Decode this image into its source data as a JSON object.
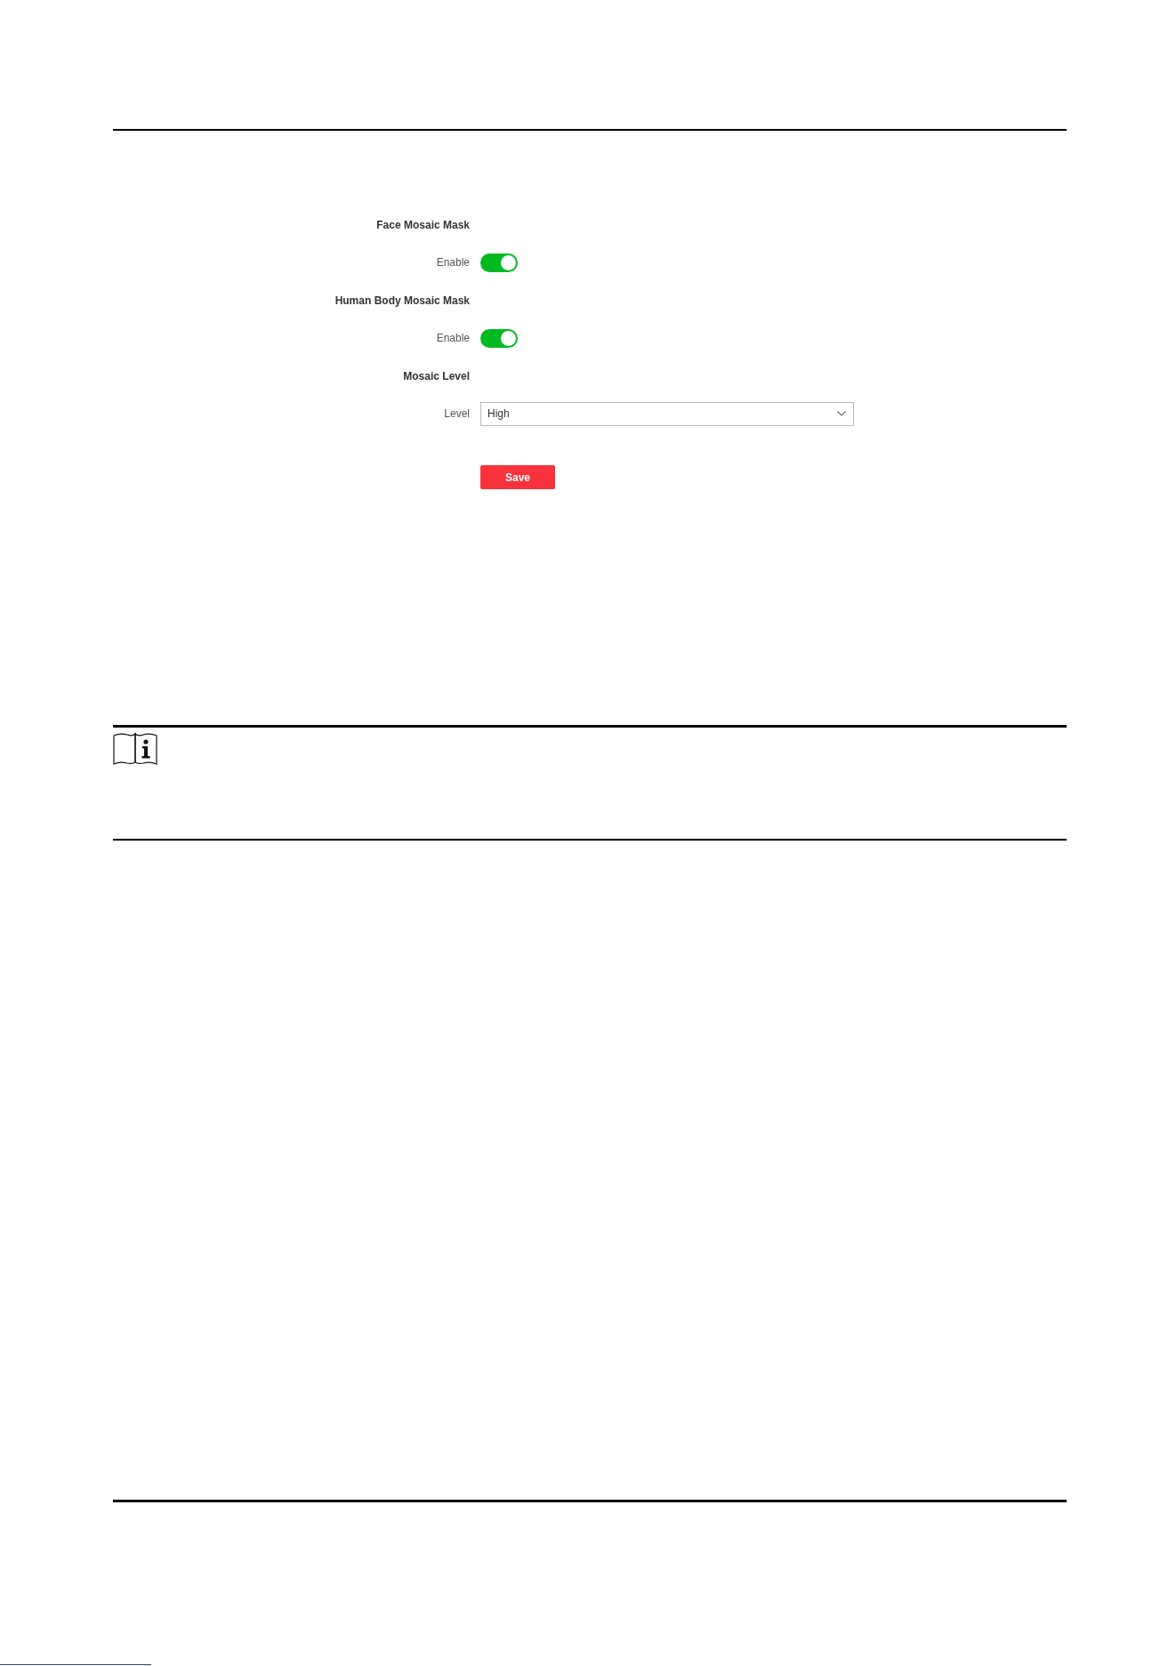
{
  "form": {
    "rows": [
      {
        "kind": "heading",
        "label": "Face Mosaic Mask"
      },
      {
        "kind": "toggle",
        "label": "Enable",
        "on": true
      },
      {
        "kind": "heading",
        "label": "Human Body Mosaic Mask"
      },
      {
        "kind": "toggle",
        "label": "Enable",
        "on": true
      },
      {
        "kind": "heading",
        "label": "Mosaic Level"
      },
      {
        "kind": "select",
        "label": "Level",
        "value": "High"
      }
    ],
    "save_button": {
      "label": "Save"
    }
  }
}
